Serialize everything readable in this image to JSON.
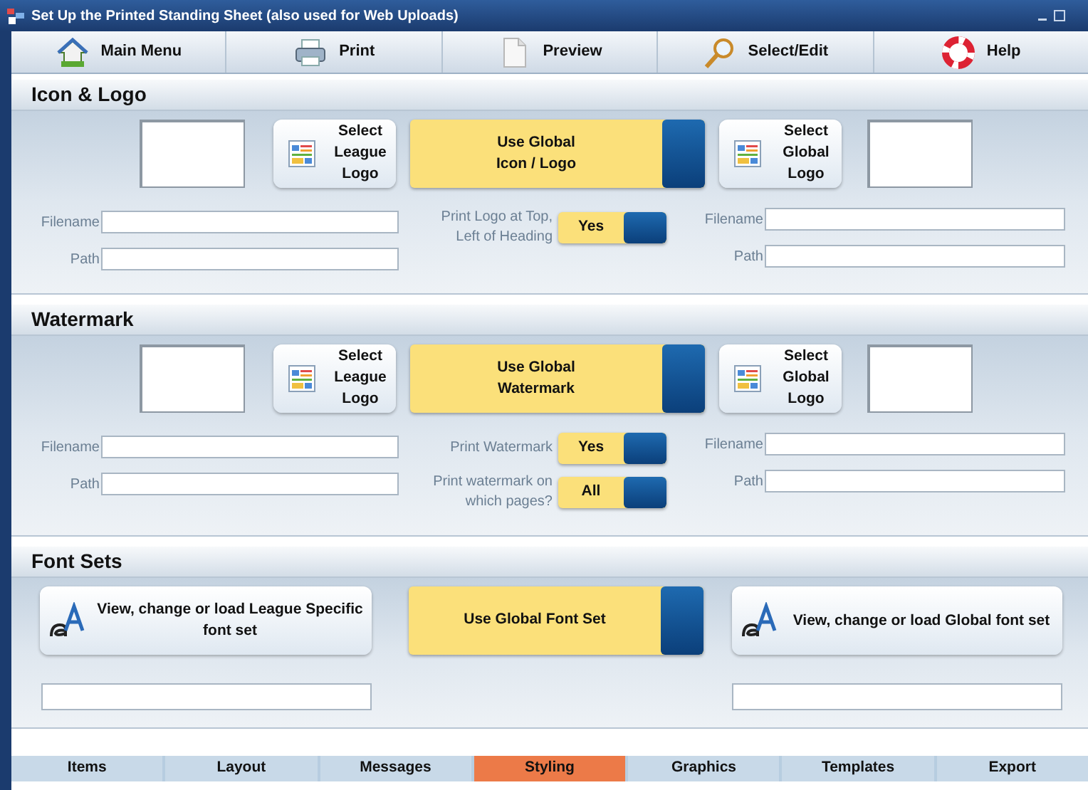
{
  "window": {
    "title": "Set Up the Printed Standing Sheet (also used for Web Uploads)"
  },
  "toolbar": [
    {
      "label": "Main Menu",
      "kind": "house"
    },
    {
      "label": "Print",
      "kind": "printer"
    },
    {
      "label": "Preview",
      "kind": "document"
    },
    {
      "label": "Select/Edit",
      "kind": "magnifier"
    },
    {
      "label": "Help",
      "kind": "lifebuoy"
    }
  ],
  "sections": [
    {
      "title": "Icon & Logo",
      "kind": "image",
      "league_button": "Select\nLeague\nLogo",
      "toggle": {
        "label": "Use Global\nIcon / Logo",
        "on": true
      },
      "global_button": "Select\nGlobal\nLogo",
      "left_fields": [
        {
          "label": "Filename"
        },
        {
          "label": "Path"
        }
      ],
      "options": [
        {
          "label": "Print Logo at Top,\nLeft of Heading",
          "value": "Yes",
          "on": true
        }
      ],
      "right_fields": [
        {
          "label": "Filename"
        },
        {
          "label": "Path"
        }
      ]
    },
    {
      "title": "Watermark",
      "kind": "image",
      "league_button": "Select\nLeague\nLogo",
      "toggle": {
        "label": "Use Global\nWatermark",
        "on": true
      },
      "global_button": "Select\nGlobal\nLogo",
      "left_fields": [
        {
          "label": "Filename"
        },
        {
          "label": "Path"
        }
      ],
      "options": [
        {
          "label": "Print Watermark",
          "value": "Yes",
          "on": true
        },
        {
          "label": "Print watermark on\nwhich pages?",
          "value": "All",
          "on": true
        }
      ],
      "right_fields": [
        {
          "label": "Filename"
        },
        {
          "label": "Path"
        }
      ]
    },
    {
      "title": "Font Sets",
      "kind": "font",
      "league_button": "View, change or load League Specific\nfont set",
      "toggle": {
        "label": "Use Global Font Set",
        "on": true
      },
      "global_button": "View, change or load Global font set"
    }
  ],
  "tabs": [
    {
      "label": "Items",
      "selected": false
    },
    {
      "label": "Layout",
      "selected": false
    },
    {
      "label": "Messages",
      "selected": false
    },
    {
      "label": "Styling",
      "selected": true
    },
    {
      "label": "Graphics",
      "selected": false
    },
    {
      "label": "Templates",
      "selected": false
    },
    {
      "label": "Export",
      "selected": false
    }
  ]
}
